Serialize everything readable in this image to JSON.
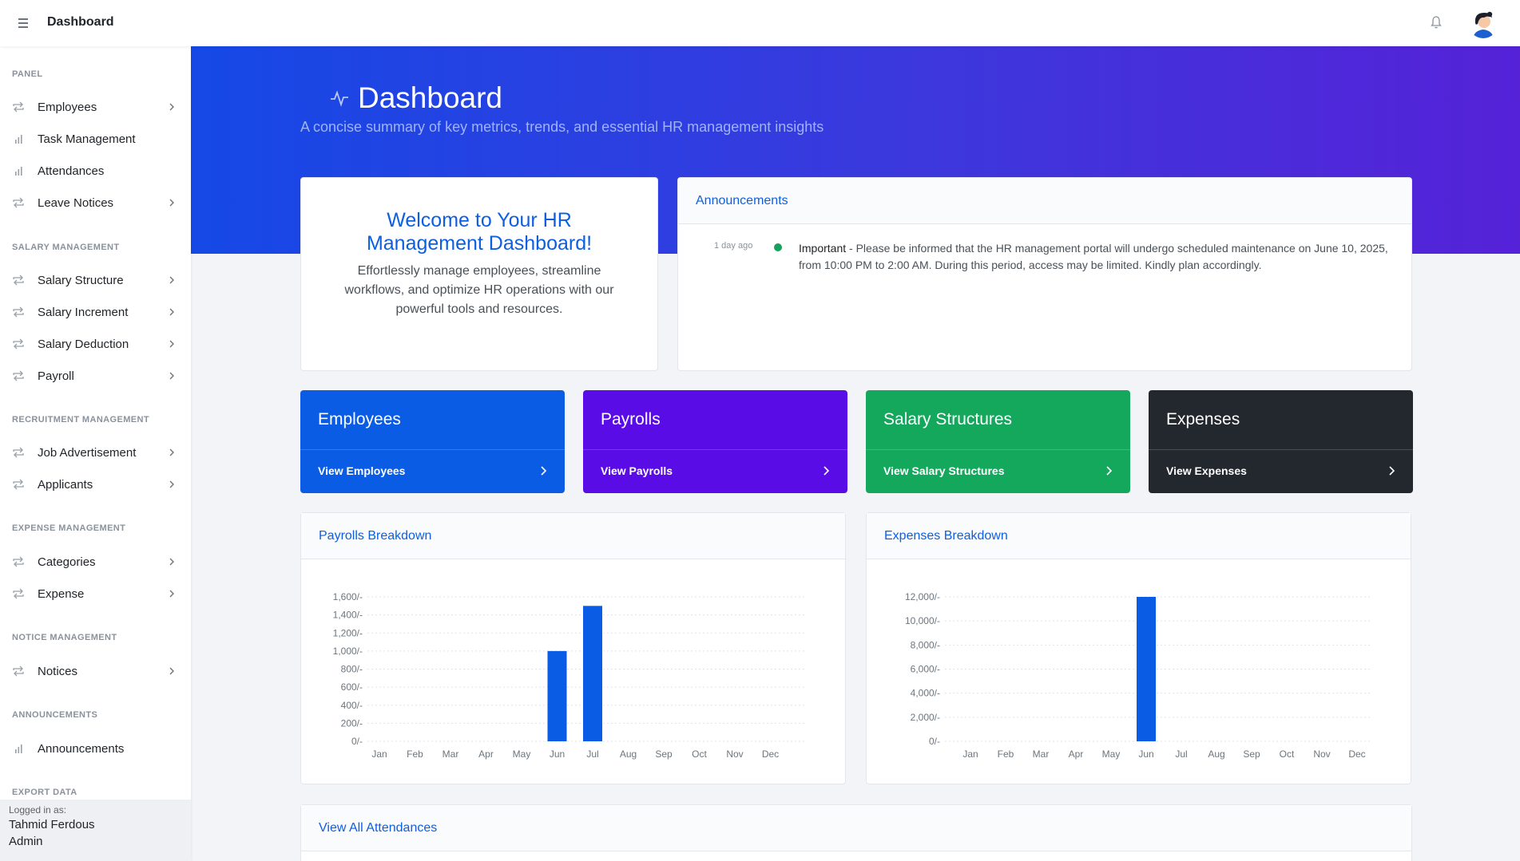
{
  "header": {
    "title": "Dashboard",
    "menu_icon": "hamburger-icon",
    "bell_icon": "bell-icon"
  },
  "sidebar": {
    "sections": [
      {
        "title": "PANEL",
        "items": [
          {
            "label": "Employees",
            "icon": "repeat-icon",
            "chevron": true
          },
          {
            "label": "Task Management",
            "icon": "bar-chart-icon",
            "chevron": false
          },
          {
            "label": "Attendances",
            "icon": "bar-chart-icon",
            "chevron": false
          },
          {
            "label": "Leave Notices",
            "icon": "repeat-icon",
            "chevron": true
          }
        ]
      },
      {
        "title": "SALARY MANAGEMENT",
        "items": [
          {
            "label": "Salary Structure",
            "icon": "repeat-icon",
            "chevron": true
          },
          {
            "label": "Salary Increment",
            "icon": "repeat-icon",
            "chevron": true
          },
          {
            "label": "Salary Deduction",
            "icon": "repeat-icon",
            "chevron": true
          },
          {
            "label": "Payroll",
            "icon": "repeat-icon",
            "chevron": true
          }
        ]
      },
      {
        "title": "RECRUITMENT MANAGEMENT",
        "items": [
          {
            "label": "Job Advertisement",
            "icon": "repeat-icon",
            "chevron": true
          },
          {
            "label": "Applicants",
            "icon": "repeat-icon",
            "chevron": true
          }
        ]
      },
      {
        "title": "EXPENSE MANAGEMENT",
        "items": [
          {
            "label": "Categories",
            "icon": "repeat-icon",
            "chevron": true
          },
          {
            "label": "Expense",
            "icon": "repeat-icon",
            "chevron": true
          }
        ]
      },
      {
        "title": "NOTICE MANAGEMENT",
        "items": [
          {
            "label": "Notices",
            "icon": "repeat-icon",
            "chevron": true
          }
        ]
      },
      {
        "title": "ANNOUNCEMENTS",
        "items": [
          {
            "label": "Announcements",
            "icon": "bar-chart-icon",
            "chevron": false
          }
        ]
      },
      {
        "title": "EXPORT DATA",
        "items": []
      }
    ],
    "footer": {
      "logged_in_as": "Logged in as:",
      "user_name": "Tahmid Ferdous",
      "role": "Admin"
    }
  },
  "hero": {
    "title": "Dashboard",
    "subtitle": "A concise summary of key metrics, trends, and essential HR management insights",
    "icon": "activity-icon"
  },
  "welcome": {
    "title": "Welcome to Your HR Management Dashboard!",
    "text": "Effortlessly manage employees, streamline workflows, and optimize HR operations with our powerful tools and resources."
  },
  "announcements": {
    "title": "Announcements",
    "items": [
      {
        "time": "1 day ago",
        "label": "Important",
        "text": " - Please be informed that the HR management portal will undergo scheduled maintenance on June 10, 2025, from 10:00 PM to 2:00 AM. During this period, access may be limited. Kindly plan accordingly.",
        "dot_color": "#18a05d"
      }
    ]
  },
  "tiles": [
    {
      "title": "Employees",
      "link": "View Employees",
      "color": "#0b5ce5"
    },
    {
      "title": "Payrolls",
      "link": "View Payrolls",
      "color": "#5a0ce6"
    },
    {
      "title": "Salary Structures",
      "link": "View Salary Structures",
      "color": "#14a85d"
    },
    {
      "title": "Expenses",
      "link": "View Expenses",
      "color": "#23272e"
    }
  ],
  "charts": {
    "payrolls_title": "Payrolls Breakdown",
    "expenses_title": "Expenses Breakdown"
  },
  "chart_data": [
    {
      "type": "bar",
      "title": "Payrolls Breakdown",
      "categories": [
        "Jan",
        "Feb",
        "Mar",
        "Apr",
        "May",
        "Jun",
        "Jul",
        "Aug",
        "Sep",
        "Oct",
        "Nov",
        "Dec"
      ],
      "values": [
        0,
        0,
        0,
        0,
        0,
        1000,
        1500,
        0,
        0,
        0,
        0,
        0
      ],
      "yticks": [
        "0/-",
        "200/-",
        "400/-",
        "600/-",
        "800/-",
        "1,000/-",
        "1,200/-",
        "1,400/-",
        "1,600/-"
      ],
      "ylim": [
        0,
        1600
      ],
      "grid": true,
      "color": "#0b5ce5"
    },
    {
      "type": "bar",
      "title": "Expenses Breakdown",
      "categories": [
        "Jan",
        "Feb",
        "Mar",
        "Apr",
        "May",
        "Jun",
        "Jul",
        "Aug",
        "Sep",
        "Oct",
        "Nov",
        "Dec"
      ],
      "values": [
        0,
        0,
        0,
        0,
        0,
        12000,
        0,
        0,
        0,
        0,
        0,
        0
      ],
      "yticks": [
        "0/-",
        "2,000/-",
        "4,000/-",
        "6,000/-",
        "8,000/-",
        "10,000/-",
        "12,000/-"
      ],
      "ylim": [
        0,
        12000
      ],
      "grid": true,
      "color": "#0b5ce5"
    }
  ],
  "attendances": {
    "title": "View All Attendances"
  }
}
